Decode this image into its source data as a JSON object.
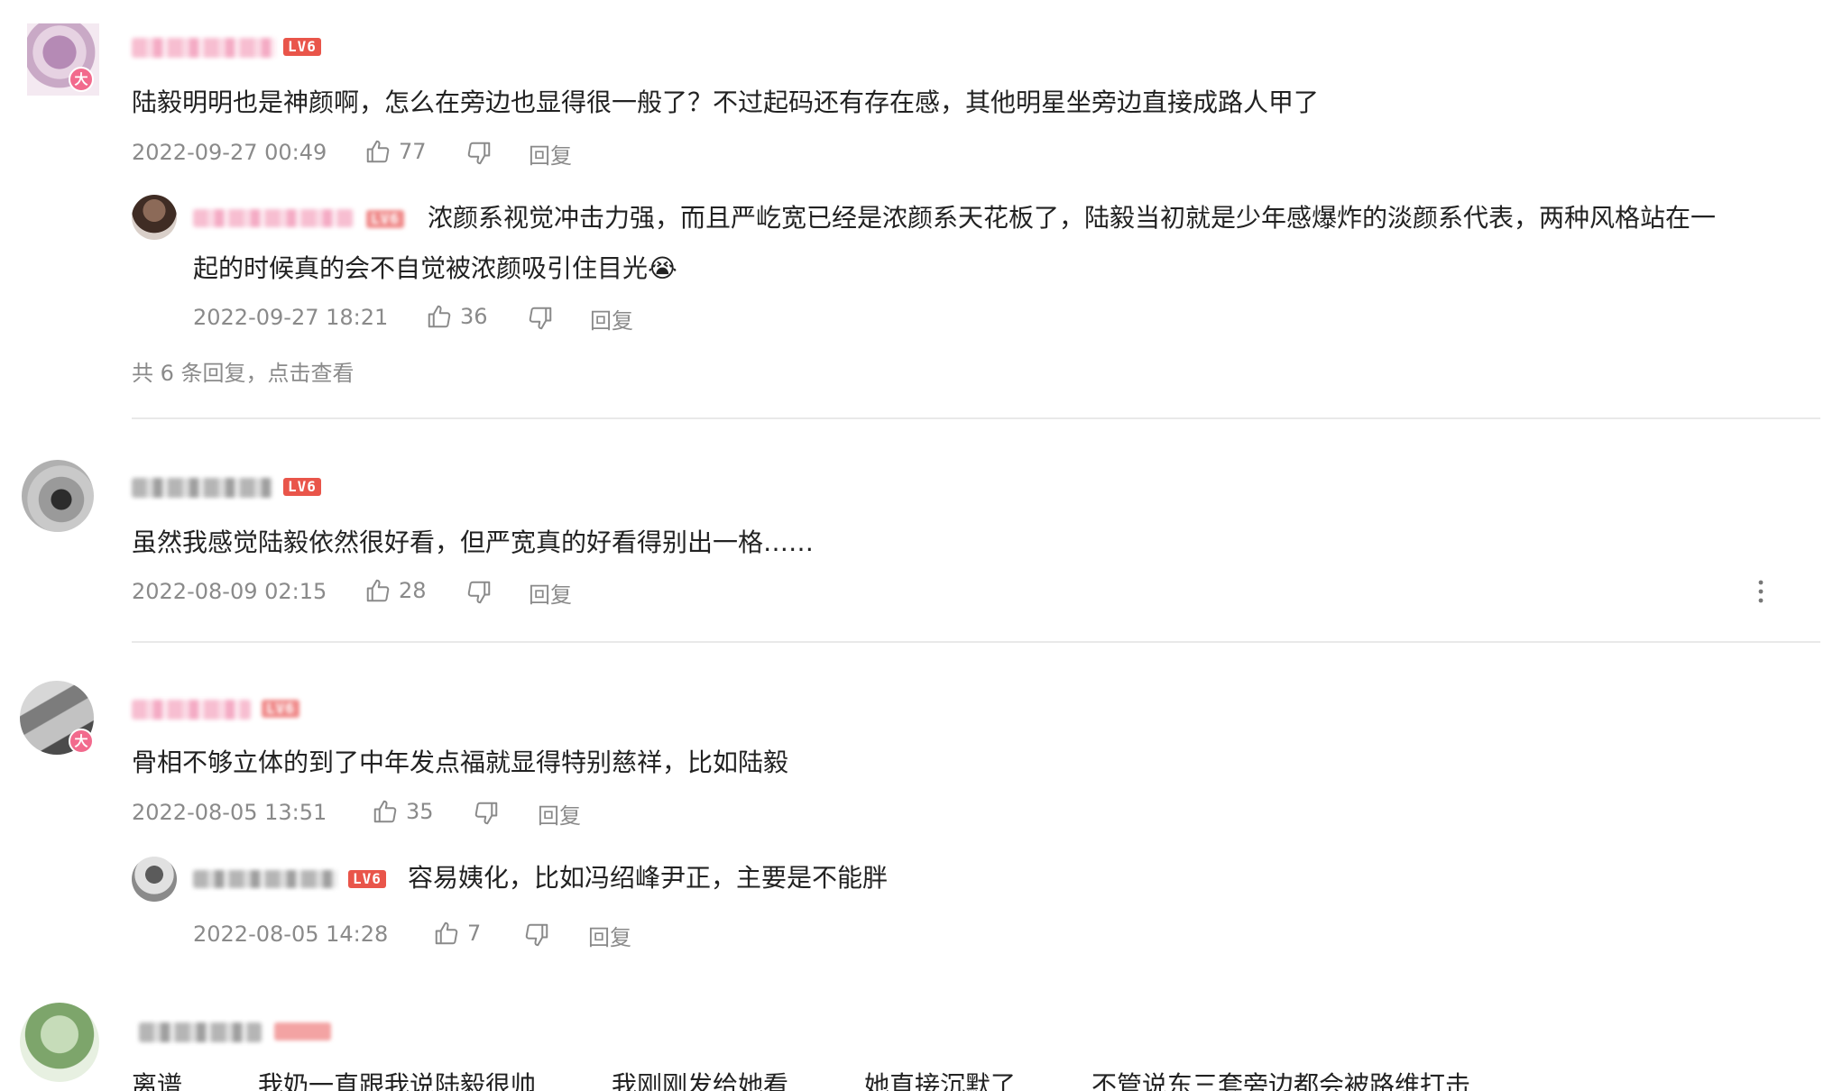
{
  "comments": [
    {
      "text": "陆毅明明也是神颜啊，怎么在旁边也显得很一般了？不过起码还有存在感，其他明星坐旁边直接成路人甲了",
      "level": "LV6",
      "badge": "大",
      "time": "2022-09-27 00:49",
      "likes": "77",
      "reply_label": "回复",
      "replies": [
        {
          "level": "LV6",
          "text_line1": "浓颜系视觉冲击力强，而且严屹宽已经是浓颜系天花板了，陆毅当初就是少年感爆炸的淡颜系代表，两种风格站在一",
          "text_line2": "起的时候真的会不自觉被浓颜吸引住目光",
          "emoji": "😭",
          "time": "2022-09-27 18:21",
          "likes": "36",
          "reply_label": "回复"
        }
      ],
      "more_replies": "共 6 条回复，点击查看"
    },
    {
      "text": "虽然我感觉陆毅依然很好看，但严宽真的好看得别出一格……",
      "level": "LV6",
      "time": "2022-08-09 02:15",
      "likes": "28",
      "reply_label": "回复",
      "more_icon": "⋮"
    },
    {
      "text": "骨相不够立体的到了中年发点福就显得特别慈祥，比如陆毅",
      "level": "LV6",
      "badge": "大",
      "time": "2022-08-05 13:51",
      "likes": "35",
      "reply_label": "回复",
      "replies": [
        {
          "level": "LV6",
          "text": "容易姨化，比如冯绍峰尹正，主要是不能胖",
          "time": "2022-08-05 14:28",
          "likes": "7",
          "reply_label": "回复"
        }
      ]
    },
    {
      "text": "离谱　　　我奶一直跟我说陆毅很帅　　　我刚刚发给她看　　　她直接沉默了　　　不管说东三套旁边都会被路维打击"
    }
  ],
  "icons": {
    "like": "thumbs-up-icon",
    "dislike": "thumbs-down-icon",
    "more": "more-vertical-icon"
  },
  "colors": {
    "level_badge": "#e9554a",
    "vip_badge": "#f26a8d",
    "meta_text": "#8a8a8a",
    "divider": "#e9e9e9"
  }
}
